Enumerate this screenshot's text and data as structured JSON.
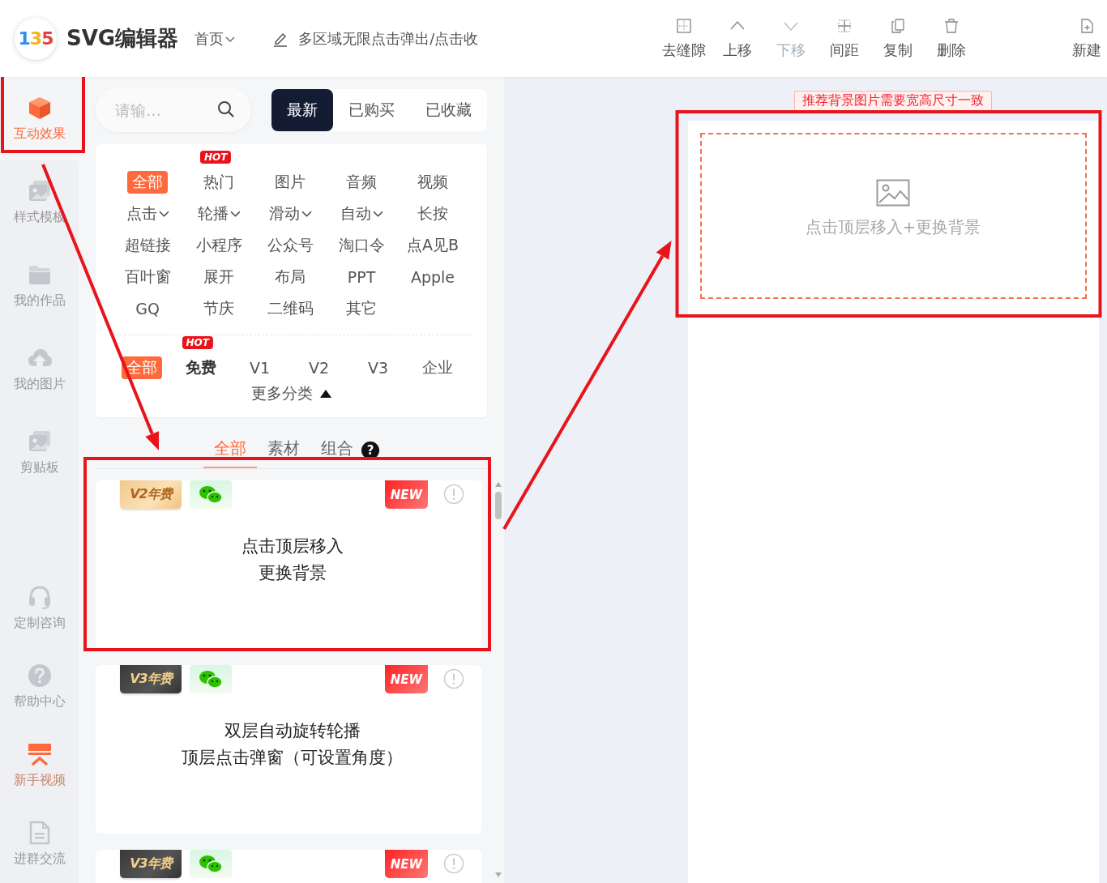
{
  "header": {
    "logo": "135",
    "title": "SVG编辑器",
    "nav_menu": "首页",
    "document_title": "多区域无限点击弹出/点击收"
  },
  "toolbar": [
    {
      "label": "去缝隙",
      "kind": "gap",
      "disabled": false
    },
    {
      "label": "上移",
      "kind": "up",
      "disabled": false
    },
    {
      "label": "下移",
      "kind": "down",
      "disabled": true
    },
    {
      "label": "间距",
      "kind": "spacing",
      "disabled": false
    },
    {
      "label": "复制",
      "kind": "copy",
      "disabled": false
    },
    {
      "label": "删除",
      "kind": "delete",
      "disabled": false
    }
  ],
  "new_button": {
    "label": "新建"
  },
  "sidebar": {
    "items": [
      {
        "label": "互动效果",
        "kind": "cube",
        "selected": true,
        "outlined": true
      },
      {
        "label": "样式模板",
        "kind": "image",
        "selected": false,
        "outlined": false
      },
      {
        "label": "我的作品",
        "kind": "folder",
        "selected": false,
        "outlined": false
      },
      {
        "label": "我的图片",
        "kind": "cloud",
        "selected": false,
        "outlined": false
      },
      {
        "label": "剪贴板",
        "kind": "image",
        "selected": false,
        "outlined": false
      }
    ],
    "bottom_items": [
      {
        "label": "定制咨询",
        "kind": "headset",
        "highlighted": false
      },
      {
        "label": "帮助中心",
        "kind": "help",
        "highlighted": false
      },
      {
        "label": "新手视频",
        "kind": "video",
        "highlighted": true
      },
      {
        "label": "进群交流",
        "kind": "document",
        "highlighted": false
      }
    ]
  },
  "panel": {
    "search": {
      "placeholder": "请输…"
    },
    "filter_tabs": [
      {
        "label": "最新",
        "selected": true
      },
      {
        "label": "已购买",
        "selected": false
      },
      {
        "label": "已收藏",
        "selected": false
      }
    ],
    "categories": [
      {
        "label": "全部",
        "selected": true,
        "dropdown": false
      },
      {
        "label": "热门",
        "selected": false,
        "dropdown": false,
        "badge": "HOT"
      },
      {
        "label": "图片",
        "selected": false,
        "dropdown": false
      },
      {
        "label": "音频",
        "selected": false,
        "dropdown": false
      },
      {
        "label": "视频",
        "selected": false,
        "dropdown": false
      },
      {
        "label": "点击",
        "selected": false,
        "dropdown": true
      },
      {
        "label": "轮播",
        "selected": false,
        "dropdown": true
      },
      {
        "label": "滑动",
        "selected": false,
        "dropdown": true
      },
      {
        "label": "自动",
        "selected": false,
        "dropdown": true
      },
      {
        "label": "长按",
        "selected": false,
        "dropdown": false
      },
      {
        "label": "超链接",
        "selected": false,
        "dropdown": false
      },
      {
        "label": "小程序",
        "selected": false,
        "dropdown": false
      },
      {
        "label": "公众号",
        "selected": false,
        "dropdown": false
      },
      {
        "label": "淘口令",
        "selected": false,
        "dropdown": false
      },
      {
        "label": "点A见B",
        "selected": false,
        "dropdown": false
      },
      {
        "label": "百叶窗",
        "selected": false,
        "dropdown": false
      },
      {
        "label": "展开",
        "selected": false,
        "dropdown": false
      },
      {
        "label": "布局",
        "selected": false,
        "dropdown": false
      },
      {
        "label": "PPT",
        "selected": false,
        "dropdown": false
      },
      {
        "label": "Apple",
        "selected": false,
        "dropdown": false
      },
      {
        "label": "GQ",
        "selected": false,
        "dropdown": false
      },
      {
        "label": "节庆",
        "selected": false,
        "dropdown": false
      },
      {
        "label": "二维码",
        "selected": false,
        "dropdown": false
      },
      {
        "label": "其它",
        "selected": false,
        "dropdown": false
      }
    ],
    "versions": [
      {
        "label": "全部",
        "selected": true
      },
      {
        "label": "免费",
        "selected": false,
        "badge": "HOT"
      },
      {
        "label": "V1",
        "selected": false
      },
      {
        "label": "V2",
        "selected": false
      },
      {
        "label": "V3",
        "selected": false
      },
      {
        "label": "企业",
        "selected": false
      }
    ],
    "more_categories": {
      "label": "更多分类",
      "expanded": true
    },
    "type_tabs": [
      {
        "label": "全部",
        "selected": true
      },
      {
        "label": "素材",
        "selected": false
      },
      {
        "label": "组合",
        "selected": false,
        "help_mark": "?"
      }
    ],
    "cards": [
      {
        "tier": {
          "label": "V2年费",
          "kind": "v2"
        },
        "badge": "NEW",
        "title": [
          "点击顶层移入",
          "更换背景"
        ],
        "outlined": true
      },
      {
        "tier": {
          "label": "V3年费",
          "kind": "v3"
        },
        "badge": "NEW",
        "title": [
          "双层自动旋转轮播",
          "顶层点击弹窗（可设置角度）"
        ],
        "outlined": false
      },
      {
        "tier": {
          "label": "V3年费",
          "kind": "v3"
        },
        "badge": "NEW",
        "outlined": false
      }
    ]
  },
  "canvas": {
    "notice": "推荐背景图片需要宽高尺寸一致",
    "placeholder": "点击顶层移入+更换背景",
    "outlined": true
  }
}
